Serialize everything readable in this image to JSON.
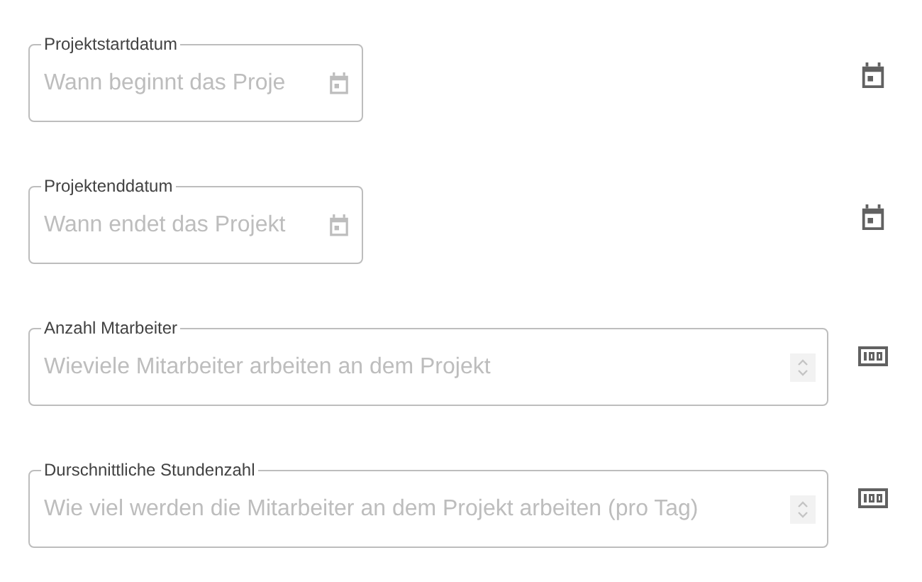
{
  "fields": [
    {
      "kind": "date",
      "label": "Projektstartdatum",
      "placeholder": "Wann beginnt das Proje"
    },
    {
      "kind": "date",
      "label": "Projektenddatum",
      "placeholder": "Wann endet das Projekt"
    },
    {
      "kind": "number",
      "label": "Anzahl Mtarbeiter",
      "placeholder": "Wieviele Mitarbeiter arbeiten an dem Projekt"
    },
    {
      "kind": "number",
      "label": "Durschnittliche Stundenzahl",
      "placeholder": "Wie viel werden die Mitarbeiter an dem Projekt arbeiten (pro Tag)"
    }
  ]
}
